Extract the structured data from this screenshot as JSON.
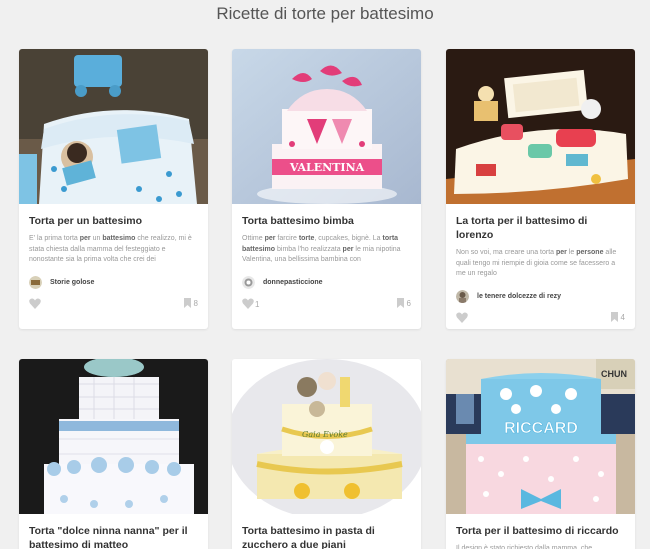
{
  "page": {
    "title": "Ricette di torte per battesimo"
  },
  "colors": {
    "background": "#f0f0f0",
    "card": "#ffffff",
    "title": "#333333",
    "muted": "#999999",
    "icon": "#cccccc"
  },
  "cards": [
    {
      "title": "Torta per un battesimo",
      "desc_parts": [
        {
          "t": "E' la prima torta ",
          "b": false
        },
        {
          "t": "per",
          "b": true
        },
        {
          "t": " un ",
          "b": false
        },
        {
          "t": "battesimo",
          "b": true
        },
        {
          "t": " che realizzo, mi è stata chiesta dalla mamma del festeggiato e nonostante sia la prima volta che crei dei",
          "b": false
        }
      ],
      "author": "Storie golose",
      "likes": "",
      "saves": "8",
      "image_icon": "baby-cake-photo"
    },
    {
      "title": "Torta battesimo bimba",
      "desc_parts": [
        {
          "t": "Ottime ",
          "b": false
        },
        {
          "t": "per",
          "b": true
        },
        {
          "t": " farcire ",
          "b": false
        },
        {
          "t": "torte",
          "b": true
        },
        {
          "t": ", cupcakes, bignè. La ",
          "b": false
        },
        {
          "t": "torta battesimo",
          "b": true
        },
        {
          "t": " bimba l'ho realizzata ",
          "b": false
        },
        {
          "t": "per",
          "b": true
        },
        {
          "t": " le mia nipotina Valentina, una bellissima bambina con",
          "b": false
        }
      ],
      "author": "donnepasticcione",
      "likes": "1",
      "saves": "6",
      "image_icon": "pink-cake-photo"
    },
    {
      "title": "La torta per il battesimo di lorenzo",
      "desc_parts": [
        {
          "t": "Non so voi, ma creare una torta ",
          "b": false
        },
        {
          "t": "per",
          "b": true
        },
        {
          "t": " le ",
          "b": false
        },
        {
          "t": "persone",
          "b": true
        },
        {
          "t": " alle quali tengo mi riempie di gioia come se facessero a me un regalo",
          "b": false
        }
      ],
      "author": "le tenere dolcezze di rezy",
      "likes": "",
      "saves": "4",
      "image_icon": "toys-cake-photo"
    },
    {
      "title": "Torta \"dolce ninna nanna\" per il battesimo di matteo",
      "desc_parts": [],
      "author": "",
      "likes": "",
      "saves": "",
      "image_icon": "tiered-cake-photo"
    },
    {
      "title": "Torta battesimo in pasta di zucchero a due piani",
      "desc_parts": [],
      "author": "",
      "likes": "",
      "saves": "",
      "image_icon": "yellow-cake-photo"
    },
    {
      "title": "Torta per il battesimo di riccardo",
      "desc_parts": [
        {
          "t": "Il design è stato richiesto dalla mamma, che",
          "b": false
        }
      ],
      "author": "",
      "likes": "",
      "saves": "",
      "image_icon": "blue-cake-photo"
    }
  ]
}
